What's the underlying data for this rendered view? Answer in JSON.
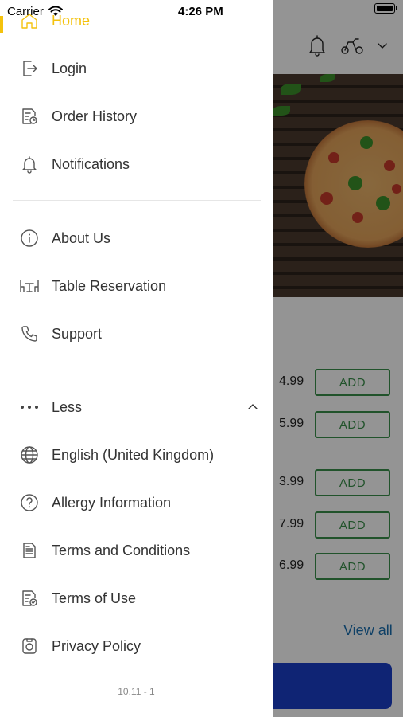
{
  "status_bar": {
    "carrier": "Carrier",
    "time": "4:26 PM"
  },
  "drawer": {
    "items": [
      {
        "label": "Home",
        "icon": "home-icon",
        "active": true
      },
      {
        "label": "Login",
        "icon": "login-icon"
      },
      {
        "label": "Order History",
        "icon": "order-history-icon"
      },
      {
        "label": "Notifications",
        "icon": "bell-icon"
      },
      {
        "label": "About Us",
        "icon": "info-icon"
      },
      {
        "label": "Table Reservation",
        "icon": "table-icon"
      },
      {
        "label": "Support",
        "icon": "phone-icon"
      },
      {
        "label": "Less",
        "icon": "more-dots-icon"
      },
      {
        "label": "English (United Kingdom)",
        "icon": "globe-icon"
      },
      {
        "label": "Allergy Information",
        "icon": "question-icon"
      },
      {
        "label": "Terms and Conditions",
        "icon": "document-icon"
      },
      {
        "label": "Terms of Use",
        "icon": "document-check-icon"
      },
      {
        "label": "Privacy Policy",
        "icon": "privacy-icon"
      }
    ],
    "version": "10.11 - 1",
    "accent_color": "#f4c20d"
  },
  "background": {
    "products": [
      {
        "price": "4.99",
        "add_label": "ADD"
      },
      {
        "price": "5.99",
        "add_label": "ADD"
      },
      {
        "price": "3.99",
        "add_label": "ADD"
      },
      {
        "price": "7.99",
        "add_label": "ADD"
      },
      {
        "price": "6.99",
        "add_label": "ADD"
      }
    ],
    "view_all": "View all",
    "cta_color": "#1b3fc9"
  }
}
